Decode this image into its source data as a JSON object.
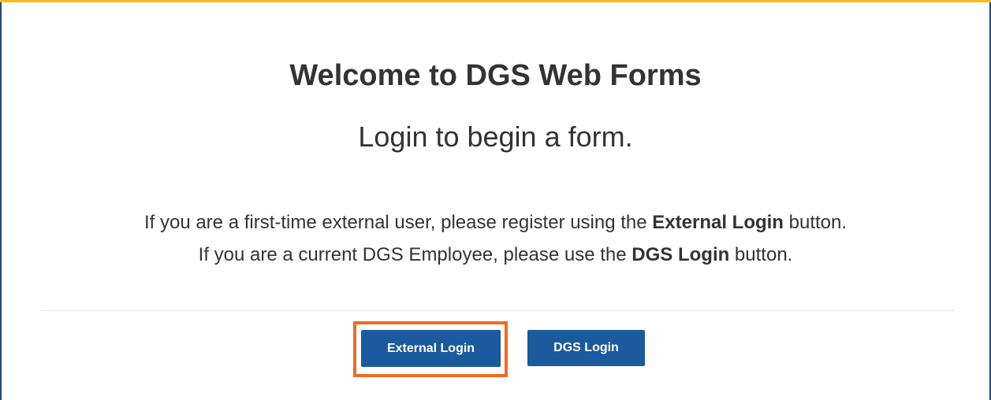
{
  "header": {
    "title": "Welcome to DGS Web Forms",
    "subtitle": "Login to begin a form."
  },
  "instructions": {
    "line1_prefix": "If you are a first-time external user, please register using the ",
    "line1_bold": "External Login",
    "line1_suffix": " button.",
    "line2_prefix": "If you are a current DGS Employee, please use the ",
    "line2_bold": "DGS Login",
    "line2_suffix": " button."
  },
  "buttons": {
    "external_login": "External Login",
    "dgs_login": "DGS Login"
  },
  "colors": {
    "accent_top": "#fdb81e",
    "frame_border": "#20467a",
    "button_bg": "#1b5a9c",
    "focus_ring": "#f26a21",
    "text": "#333333"
  }
}
